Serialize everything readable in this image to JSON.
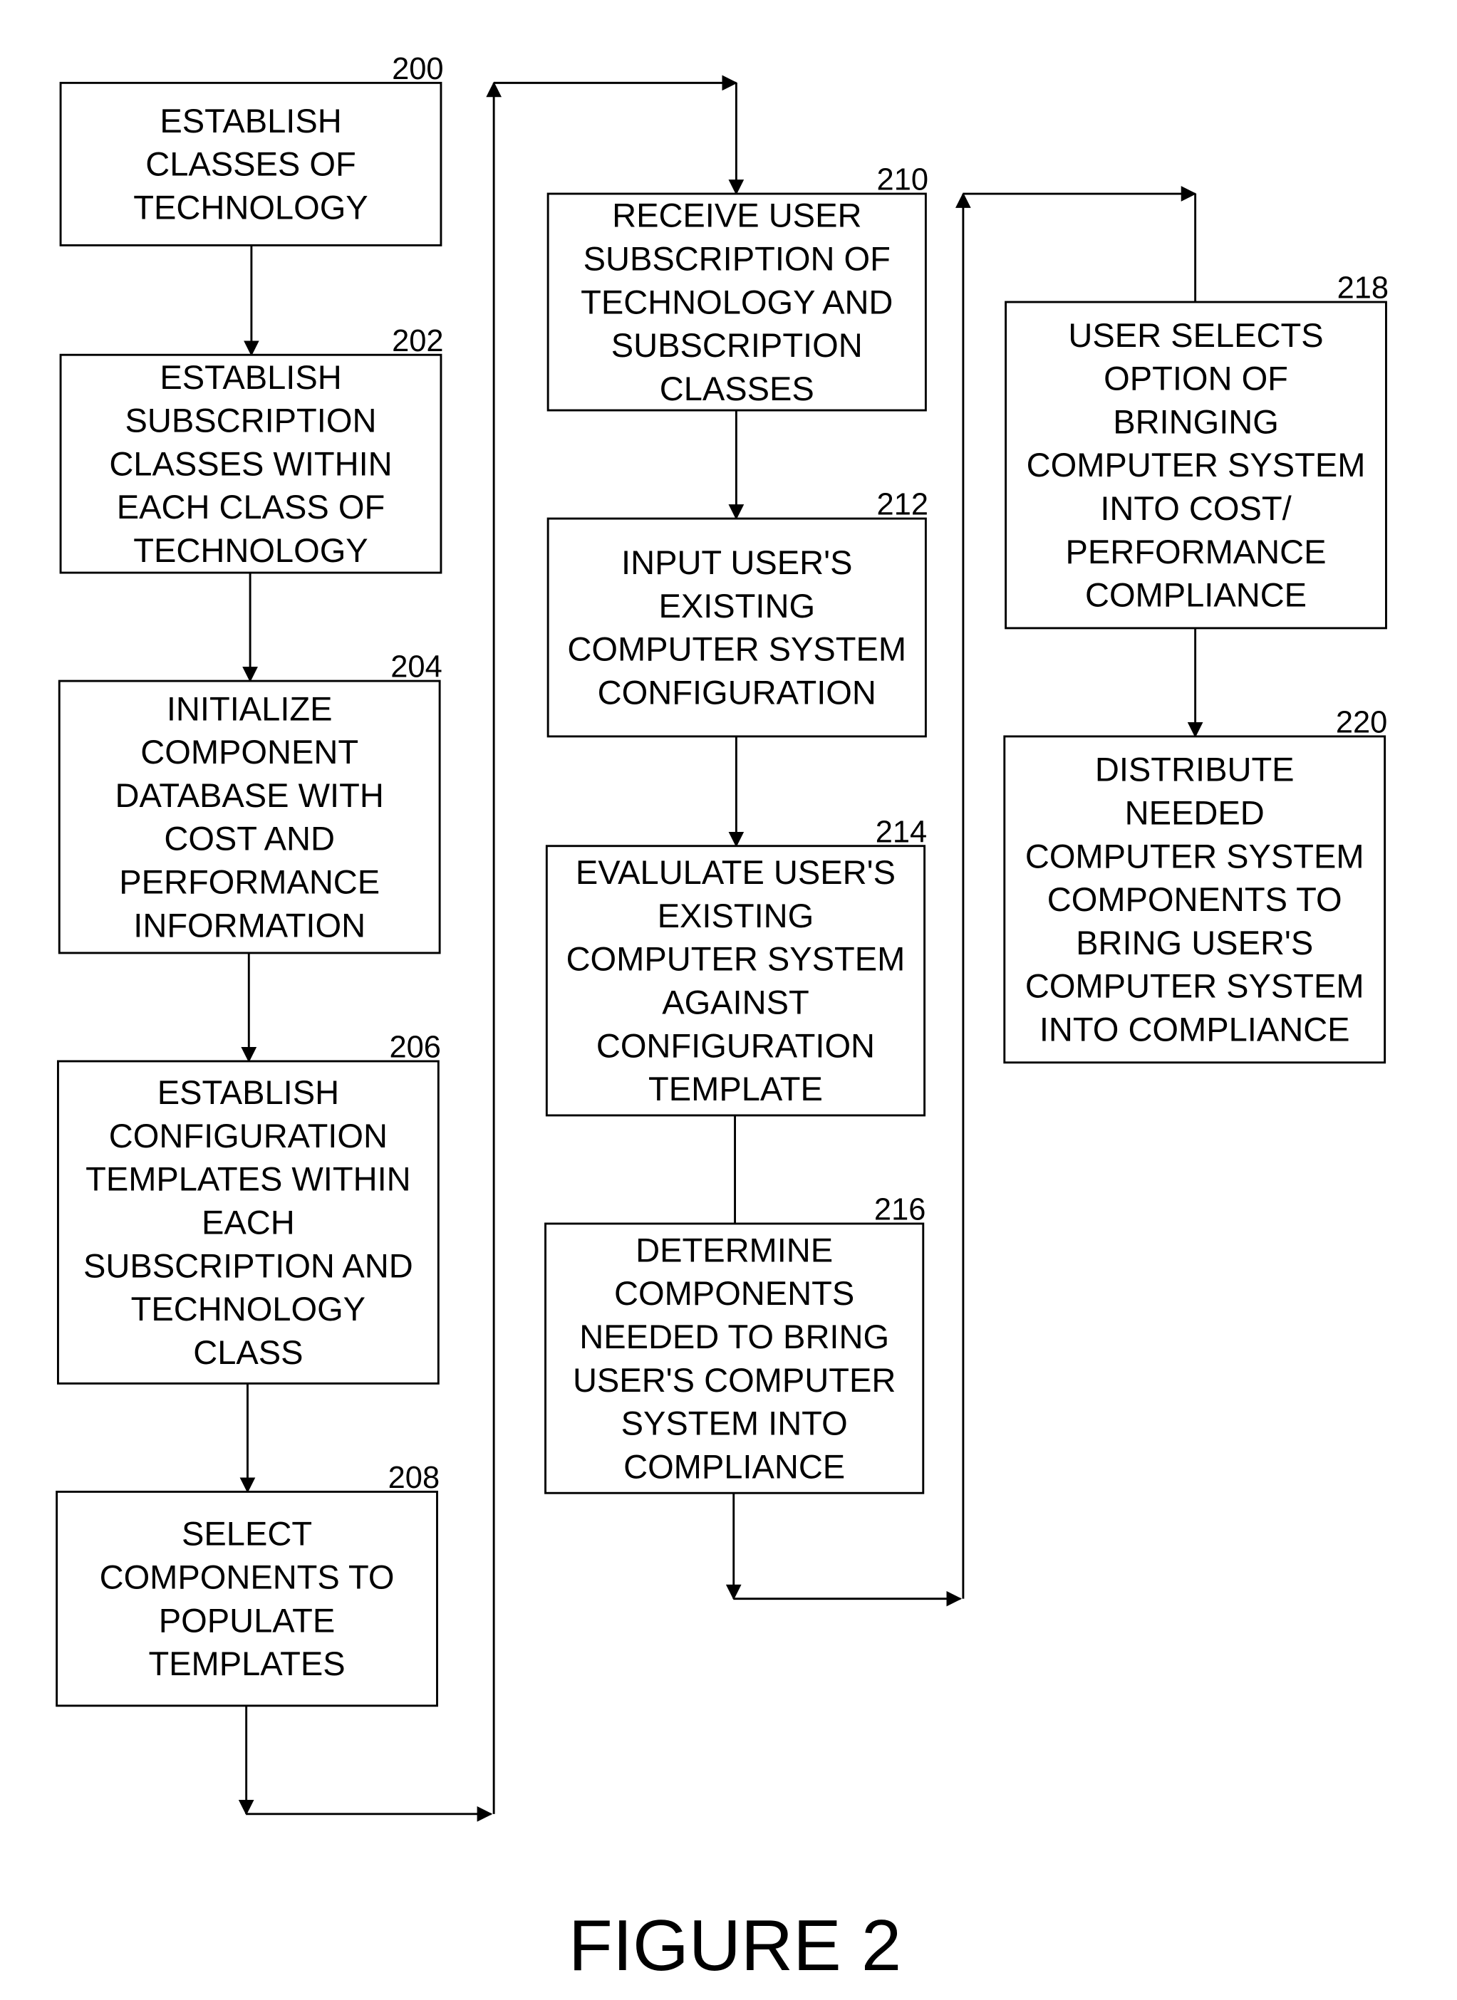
{
  "figure": {
    "caption": "FIGURE 2"
  },
  "steps": [
    {
      "id": "200",
      "lines": [
        "ESTABLISH",
        "CLASSES OF",
        "TECHNOLOGY"
      ]
    },
    {
      "id": "202",
      "lines": [
        "ESTABLISH",
        "SUBSCRIPTION",
        "CLASSES WITHIN",
        "EACH CLASS OF",
        "TECHNOLOGY"
      ]
    },
    {
      "id": "204",
      "lines": [
        "INITIALIZE",
        "COMPONENT",
        "DATABASE WITH",
        "COST AND",
        "PERFORMANCE",
        "INFORMATION"
      ]
    },
    {
      "id": "206",
      "lines": [
        "ESTABLISH",
        "CONFIGURATION",
        "TEMPLATES WITHIN",
        "EACH",
        "SUBSCRIPTION AND",
        "TECHNOLOGY",
        "CLASS"
      ]
    },
    {
      "id": "208",
      "lines": [
        "SELECT",
        "COMPONENTS TO",
        "POPULATE",
        "TEMPLATES"
      ]
    },
    {
      "id": "210",
      "lines": [
        "RECEIVE USER",
        "SUBSCRIPTION OF",
        "TECHNOLOGY AND",
        "SUBSCRIPTION",
        "CLASSES"
      ]
    },
    {
      "id": "212",
      "lines": [
        "INPUT USER'S",
        "EXISTING",
        "COMPUTER SYSTEM",
        "CONFIGURATION"
      ]
    },
    {
      "id": "214",
      "lines": [
        "EVALULATE USER'S",
        "EXISTING",
        "COMPUTER SYSTEM",
        "AGAINST",
        "CONFIGURATION",
        "TEMPLATE"
      ]
    },
    {
      "id": "216",
      "lines": [
        "DETERMINE",
        "COMPONENTS",
        "NEEDED TO BRING",
        "USER'S COMPUTER",
        "SYSTEM INTO",
        "COMPLIANCE"
      ]
    },
    {
      "id": "218",
      "lines": [
        "USER SELECTS",
        "OPTION OF",
        "BRINGING",
        "COMPUTER SYSTEM",
        "INTO COST/",
        "PERFORMANCE",
        "COMPLIANCE"
      ]
    },
    {
      "id": "220",
      "lines": [
        "DISTRIBUTE",
        "NEEDED",
        "COMPUTER SYSTEM",
        "COMPONENTS TO",
        "BRING USER'S",
        "COMPUTER SYSTEM",
        "INTO COMPLIANCE"
      ]
    }
  ]
}
